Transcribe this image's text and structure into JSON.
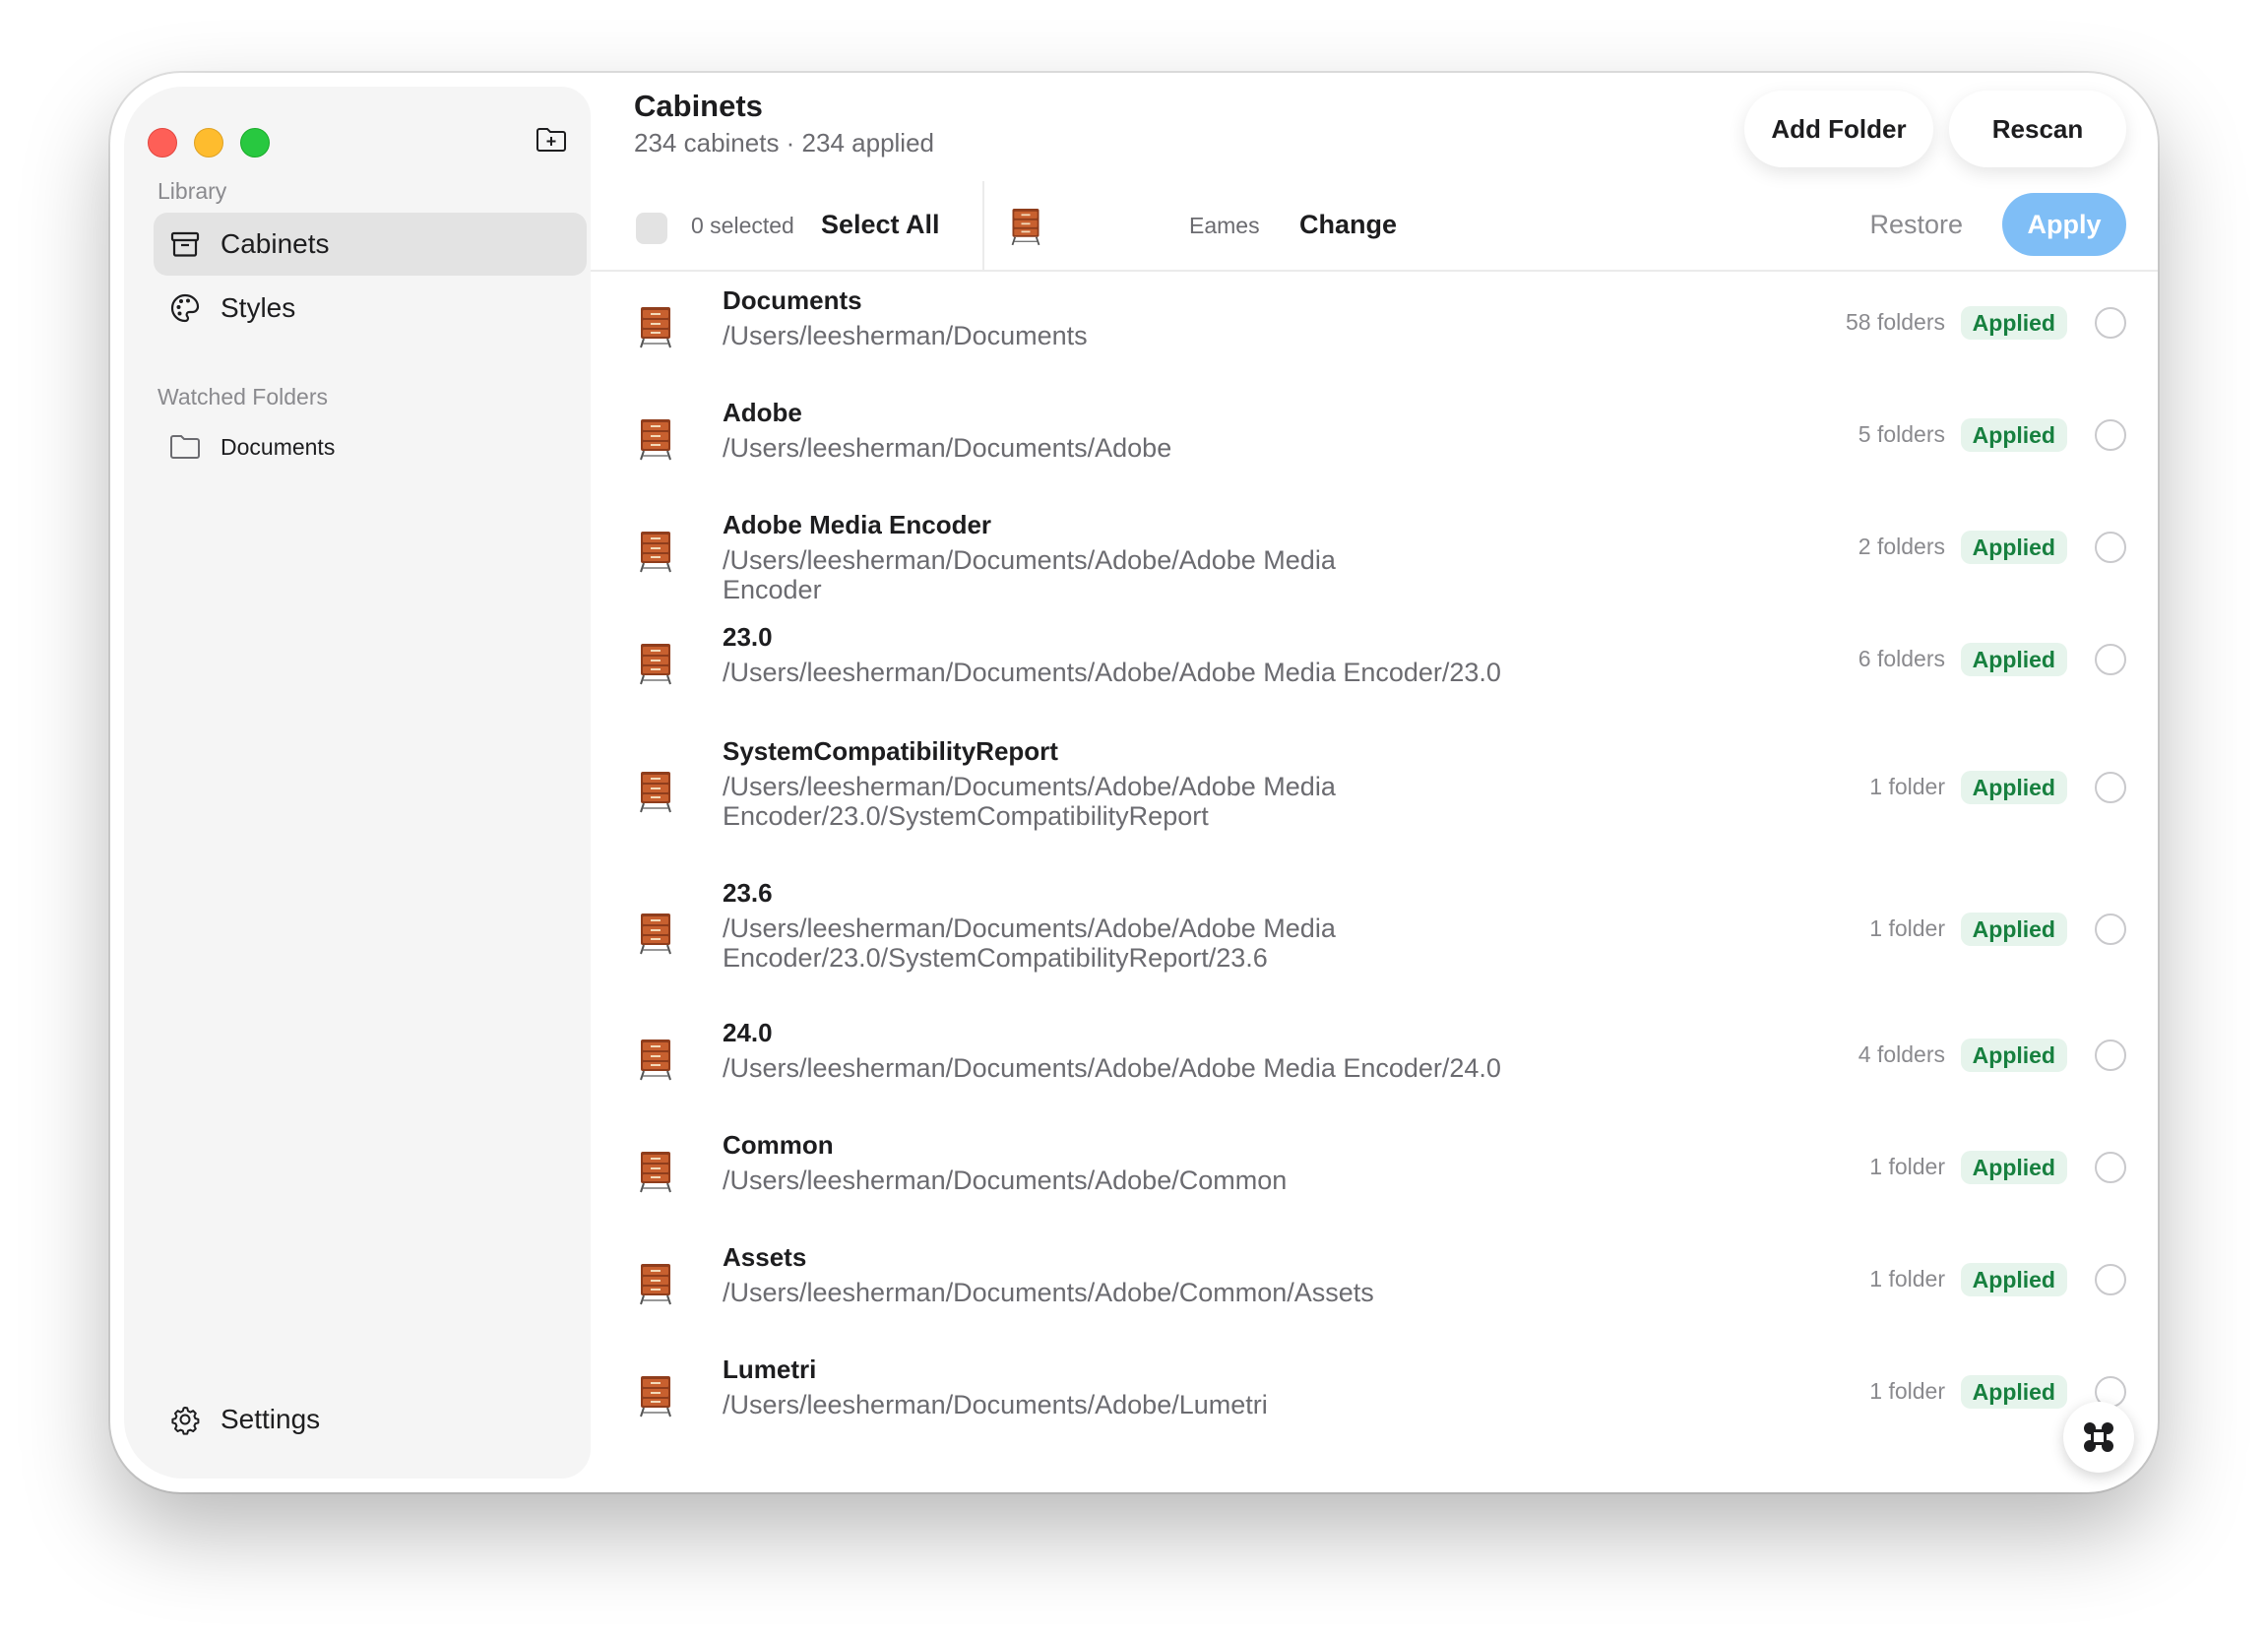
{
  "sidebar": {
    "library_label": "Library",
    "items": [
      {
        "label": "Cabinets",
        "icon": "archive-box-icon",
        "active": true
      },
      {
        "label": "Styles",
        "icon": "palette-icon",
        "active": false
      }
    ],
    "watched_label": "Watched Folders",
    "watched_folders": [
      {
        "label": "Documents",
        "icon": "folder-icon"
      }
    ],
    "settings_label": "Settings"
  },
  "header": {
    "title": "Cabinets",
    "subtitle": "234 cabinets · 234 applied",
    "add_folder_label": "Add Folder",
    "rescan_label": "Rescan"
  },
  "toolbar": {
    "selected_text": "0 selected",
    "select_all_label": "Select All",
    "style_name": "Eames",
    "change_label": "Change",
    "restore_label": "Restore",
    "apply_label": "Apply"
  },
  "rows": [
    {
      "name": "Documents",
      "path": "/Users/leesherman/Documents",
      "count": "58 folders",
      "status": "Applied"
    },
    {
      "name": "Adobe",
      "path": "/Users/leesherman/Documents/Adobe",
      "count": "5 folders",
      "status": "Applied"
    },
    {
      "name": "Adobe Media Encoder",
      "path": "/Users/leesherman/Documents/Adobe/Adobe Media Encoder",
      "count": "2 folders",
      "status": "Applied"
    },
    {
      "name": "23.0",
      "path": "/Users/leesherman/Documents/Adobe/Adobe Media Encoder/23.0",
      "count": "6 folders",
      "status": "Applied"
    },
    {
      "name": "SystemCompatibilityReport",
      "path": "/Users/leesherman/Documents/Adobe/Adobe Media Encoder/23.0/SystemCompatibilityReport",
      "count": "1 folder",
      "status": "Applied"
    },
    {
      "name": "23.6",
      "path": "/Users/leesherman/Documents/Adobe/Adobe Media Encoder/23.0/SystemCompatibilityReport/23.6",
      "count": "1 folder",
      "status": "Applied"
    },
    {
      "name": "24.0",
      "path": "/Users/leesherman/Documents/Adobe/Adobe Media Encoder/24.0",
      "count": "4 folders",
      "status": "Applied"
    },
    {
      "name": "Common",
      "path": "/Users/leesherman/Documents/Adobe/Common",
      "count": "1 folder",
      "status": "Applied"
    },
    {
      "name": "Assets",
      "path": "/Users/leesherman/Documents/Adobe/Common/Assets",
      "count": "1 folder",
      "status": "Applied"
    },
    {
      "name": "Lumetri",
      "path": "/Users/leesherman/Documents/Adobe/Lumetri",
      "count": "1 folder",
      "status": "Applied"
    }
  ],
  "colors": {
    "accent": "#7fbef6",
    "applied_bg": "#e6f4ec",
    "applied_text": "#17803f",
    "cabinet_wood": "#b5532a"
  }
}
